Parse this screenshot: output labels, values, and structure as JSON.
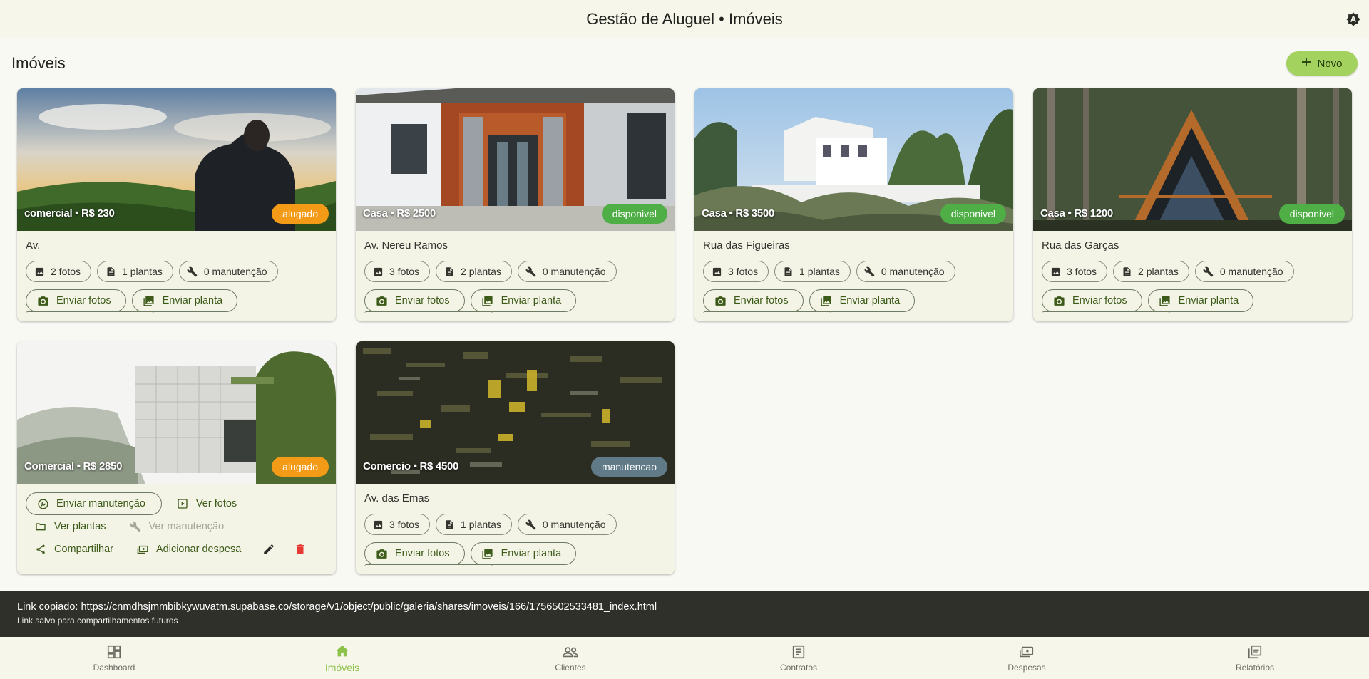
{
  "app": {
    "title": "Gestão de Aluguel • Imóveis",
    "theme_icon": "brightness-auto-icon"
  },
  "page": {
    "heading": "Imóveis",
    "new_button": "Novo"
  },
  "colors": {
    "accent": "#a3d25e",
    "alugado": "#f39a16",
    "disponivel": "#4fae46",
    "manutencao": "#607a87"
  },
  "properties": [
    {
      "caption": "comercial • R$ 230",
      "status": "alugado",
      "address": "Av.",
      "fotos": "2 fotos",
      "plantas": "1 plantas",
      "manutencao": "0 manutenção",
      "btn_fotos": "Enviar fotos",
      "btn_planta": "Enviar planta"
    },
    {
      "caption": "Casa • R$ 2500",
      "status": "disponivel",
      "address": "Av. Nereu Ramos",
      "fotos": "3 fotos",
      "plantas": "2 plantas",
      "manutencao": "0 manutenção",
      "btn_fotos": "Enviar fotos",
      "btn_planta": "Enviar planta"
    },
    {
      "caption": "Casa • R$ 3500",
      "status": "disponivel",
      "address": "Rua das Figueiras",
      "fotos": "3 fotos",
      "plantas": "1 plantas",
      "manutencao": "0 manutenção",
      "btn_fotos": "Enviar fotos",
      "btn_planta": "Enviar planta"
    },
    {
      "caption": "Casa • R$ 1200",
      "status": "disponivel",
      "address": "Rua das Garças",
      "fotos": "3 fotos",
      "plantas": "2 plantas",
      "manutencao": "0 manutenção",
      "btn_fotos": "Enviar fotos",
      "btn_planta": "Enviar planta"
    },
    {
      "caption": "Comercial • R$ 2850",
      "status": "alugado",
      "actions": {
        "enviar_manutencao": "Enviar manutenção",
        "ver_fotos": "Ver fotos",
        "ver_plantas": "Ver plantas",
        "ver_manutencao": "Ver manutenção",
        "compartilhar": "Compartilhar",
        "adicionar_despesa": "Adicionar despesa"
      }
    },
    {
      "caption": "Comercio • R$ 4500",
      "status": "manutencao",
      "address": "Av. das Emas",
      "fotos": "3 fotos",
      "plantas": "1 plantas",
      "manutencao": "0 manutenção",
      "btn_fotos": "Enviar fotos",
      "btn_planta": "Enviar planta"
    }
  ],
  "snackbar": {
    "line1": "Link copiado: https://cnmdhsjmmbibkywuvatm.supabase.co/storage/v1/object/public/galeria/shares/imoveis/166/1756502533481_index.html",
    "line2": "Link salvo para compartilhamentos futuros"
  },
  "nav": [
    {
      "label": "Dashboard",
      "icon": "dashboard-icon"
    },
    {
      "label": "Imóveis",
      "icon": "home-icon"
    },
    {
      "label": "Clientes",
      "icon": "people-icon"
    },
    {
      "label": "Contratos",
      "icon": "contract-icon"
    },
    {
      "label": "Despesas",
      "icon": "payments-icon"
    },
    {
      "label": "Relatórios",
      "icon": "pdf-report-icon"
    }
  ]
}
